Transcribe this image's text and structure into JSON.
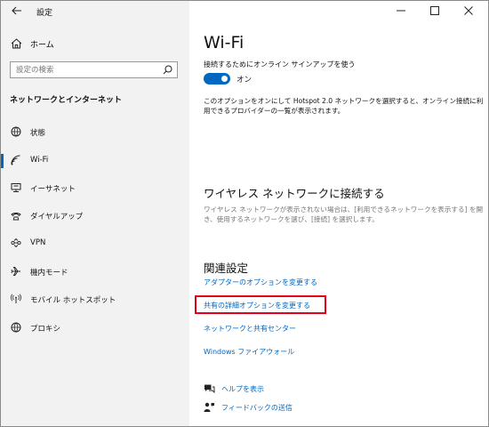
{
  "app": {
    "title": "設定"
  },
  "sidebar": {
    "home_label": "ホーム",
    "search_placeholder": "設定の検索",
    "section_title": "ネットワークとインターネット",
    "items": [
      {
        "label": "状態",
        "icon": "globe-status-icon"
      },
      {
        "label": "Wi-Fi",
        "icon": "wifi-icon",
        "active": true
      },
      {
        "label": "イーサネット",
        "icon": "ethernet-icon"
      },
      {
        "label": "ダイヤルアップ",
        "icon": "dialup-icon"
      },
      {
        "label": "VPN",
        "icon": "vpn-icon"
      },
      {
        "label": "機内モード",
        "icon": "airplane-icon"
      },
      {
        "label": "モバイル ホットスポット",
        "icon": "hotspot-icon"
      },
      {
        "label": "プロキシ",
        "icon": "proxy-globe-icon"
      }
    ]
  },
  "main": {
    "title": "Wi-Fi",
    "option_label": "接続するためにオンライン サインアップを使う",
    "toggle_state": "オン",
    "description": "このオプションをオンにして Hotspot 2.0 ネットワークを選択すると、オンライン接続に利用できるプロバイダーの一覧が表示されます。",
    "wireless_heading": "ワイヤレス ネットワークに接続する",
    "wireless_hint": "ワイヤレス ネットワークが表示されない場合は、[利用できるネットワークを表示する] を開き、使用するネットワークを選び、[接続] を選択します。",
    "related_heading": "関連設定",
    "links": [
      "アダプターのオプションを変更する",
      "共有の詳細オプションを変更する",
      "ネットワークと共有センター",
      "Windows ファイアウォール"
    ],
    "help_label": "ヘルプを表示",
    "feedback_label": "フィードバックの送信"
  },
  "colors": {
    "accent": "#0067c0",
    "highlight": "#e3001b",
    "sidebar_bg": "#f2f2f2"
  }
}
